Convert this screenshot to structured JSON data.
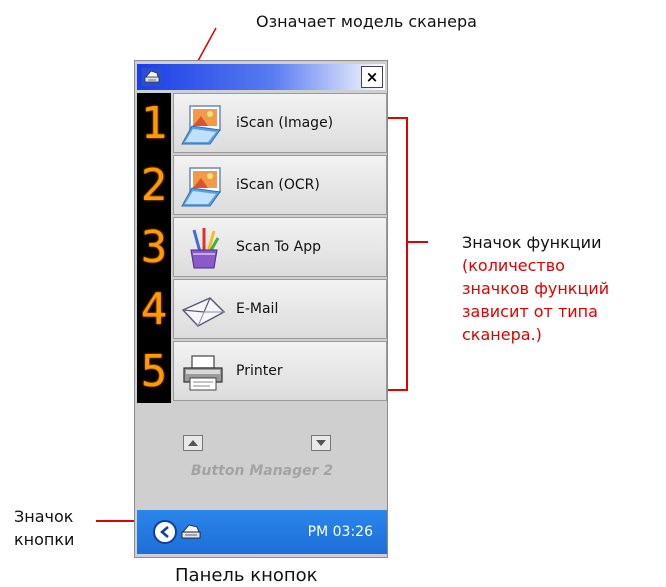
{
  "annotations": {
    "scanner_model": "Означает модель сканера",
    "function_icon": "Значок функции",
    "function_note_1": "(количество",
    "function_note_2": "значков функций",
    "function_note_3": "зависит от типа",
    "function_note_4": "сканера.)",
    "button_icon_1": "Значок",
    "button_icon_2": "кнопки",
    "panel_caption": "Панель кнопок"
  },
  "window": {
    "close_glyph": "×",
    "buttons": [
      {
        "number": "1",
        "label": "iScan (Image)",
        "icon": "image-scan-icon"
      },
      {
        "number": "2",
        "label": "iScan (OCR)",
        "icon": "ocr-scan-icon"
      },
      {
        "number": "3",
        "label": "Scan To App",
        "icon": "paint-brushes-icon"
      },
      {
        "number": "4",
        "label": "E-Mail",
        "icon": "envelope-icon"
      },
      {
        "number": "5",
        "label": "Printer",
        "icon": "printer-icon"
      }
    ],
    "brand": "Button Manager 2"
  },
  "taskbar": {
    "time": "PM 03:26"
  },
  "colors": {
    "annotation_red": "#e00000",
    "digit_orange": "#ff9a00",
    "titlebar_blue": "#1a3ee6",
    "taskbar_blue": "#1d6fd8"
  }
}
